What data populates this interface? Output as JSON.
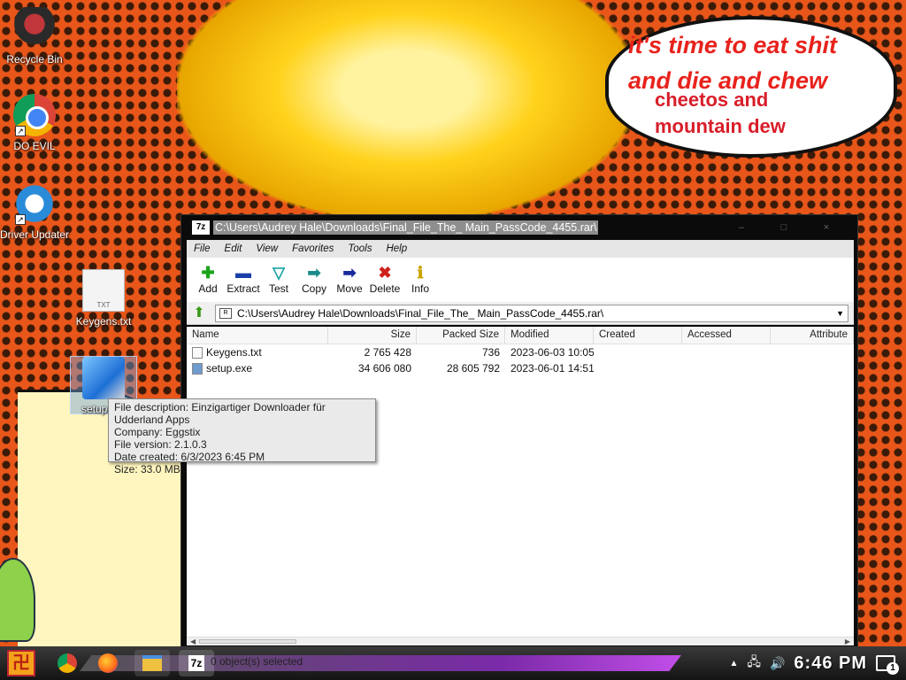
{
  "wallpaper": {
    "bubble_line1": "it's time to eat shit",
    "bubble_line2": "and die and chew",
    "bubble_line3": "cheetos and",
    "bubble_line4": "mountain dew"
  },
  "desktop_icons": [
    {
      "label": "Recycle Bin",
      "icon": "recycle-bin-icon"
    },
    {
      "label": "DO EVIL",
      "icon": "chrome-icon"
    },
    {
      "label": "Driver Updater",
      "icon": "driver-updater-icon"
    },
    {
      "label": "Keygens.txt",
      "icon": "text-file-icon"
    },
    {
      "label": "setup.",
      "icon": "installer-icon"
    }
  ],
  "tooltip": {
    "line1": "File description: Einzigartiger Downloader für Udderland Apps",
    "line2": "Company: Eggstix",
    "line3": "File version: 2.1.0.3",
    "line4": "Date created: 6/3/2023 6:45 PM",
    "line5": "Size: 33.0 MB"
  },
  "window": {
    "app_icon": "7z",
    "title": "C:\\Users\\Audrey Hale\\Downloads\\Final_File_The_ Main_PassCode_4455.rar\\",
    "controls": {
      "minimize": "–",
      "maximize": "□",
      "close": "×"
    },
    "menu": [
      "File",
      "Edit",
      "View",
      "Favorites",
      "Tools",
      "Help"
    ],
    "toolbar": [
      {
        "label": "Add",
        "icon": "plus-icon",
        "color": "#1aa31a"
      },
      {
        "label": "Extract",
        "icon": "minus-icon",
        "color": "#1a3fa8"
      },
      {
        "label": "Test",
        "icon": "check-icon",
        "color": "#1aa3a3"
      },
      {
        "label": "Copy",
        "icon": "copy-arrow-icon",
        "color": "#1a8a8a"
      },
      {
        "label": "Move",
        "icon": "move-arrow-icon",
        "color": "#1a2a9a"
      },
      {
        "label": "Delete",
        "icon": "delete-x-icon",
        "color": "#d0201c"
      },
      {
        "label": "Info",
        "icon": "info-icon",
        "color": "#c9a400"
      }
    ],
    "address": "C:\\Users\\Audrey Hale\\Downloads\\Final_File_The_ Main_PassCode_4455.rar\\",
    "columns": {
      "name": "Name",
      "size": "Size",
      "packed": "Packed Size",
      "modified": "Modified",
      "created": "Created",
      "accessed": "Accessed",
      "attributes": "Attribute"
    },
    "files": [
      {
        "name": "Keygens.txt",
        "size": "2 765 428",
        "packed": "736",
        "modified": "2023-06-03 10:05",
        "type": "txt"
      },
      {
        "name": "setup.exe",
        "size": "34 606 080",
        "packed": "28 605 792",
        "modified": "2023-06-01 14:51",
        "type": "exe"
      }
    ]
  },
  "taskbar": {
    "status_text": "0 object(s) selected",
    "clock": "6:46 PM",
    "notification_count": "1"
  }
}
